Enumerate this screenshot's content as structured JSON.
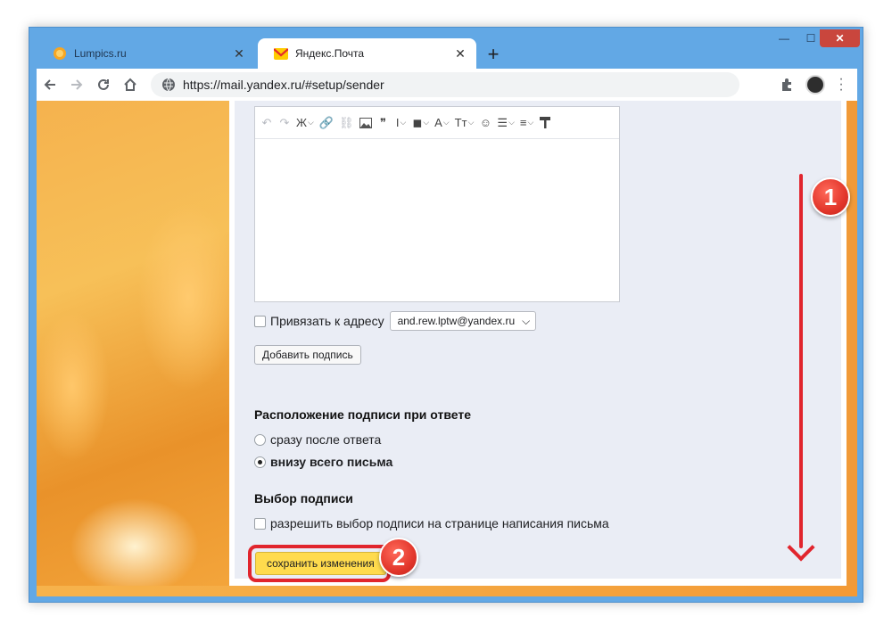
{
  "browser": {
    "tabs": [
      {
        "title": "Lumpics.ru",
        "icon": "lumpics-orange-icon",
        "active": false
      },
      {
        "title": "Яндекс.Почта",
        "icon": "yandex-mail-icon",
        "active": true
      }
    ],
    "new_tab_symbol": "+",
    "window_controls": {
      "minimize": "—",
      "maximize": "☐",
      "close": "✕"
    },
    "address": "https://mail.yandex.ru/#setup/sender"
  },
  "editor": {
    "tools": [
      "undo",
      "redo",
      "Ж",
      "link",
      "unlink",
      "image",
      "quote",
      "I",
      "T",
      "A",
      "Tт",
      "emoji",
      "list",
      "align",
      "format-paint"
    ]
  },
  "bind_address": {
    "label": "Привязать к адресу",
    "selected": "and.rew.lptw@yandex.ru"
  },
  "add_signature_label": "Добавить подпись",
  "placement": {
    "heading": "Расположение подписи при ответе",
    "options": [
      {
        "label": "сразу после ответа",
        "checked": false
      },
      {
        "label": "внизу всего письма",
        "checked": true
      }
    ]
  },
  "choice": {
    "heading": "Выбор подписи",
    "checkbox_label": "разрешить выбор подписи на странице написания письма"
  },
  "save_label": "сохранить изменения",
  "annotations": {
    "step1": "1",
    "step2": "2",
    "color": "#e1252d"
  }
}
